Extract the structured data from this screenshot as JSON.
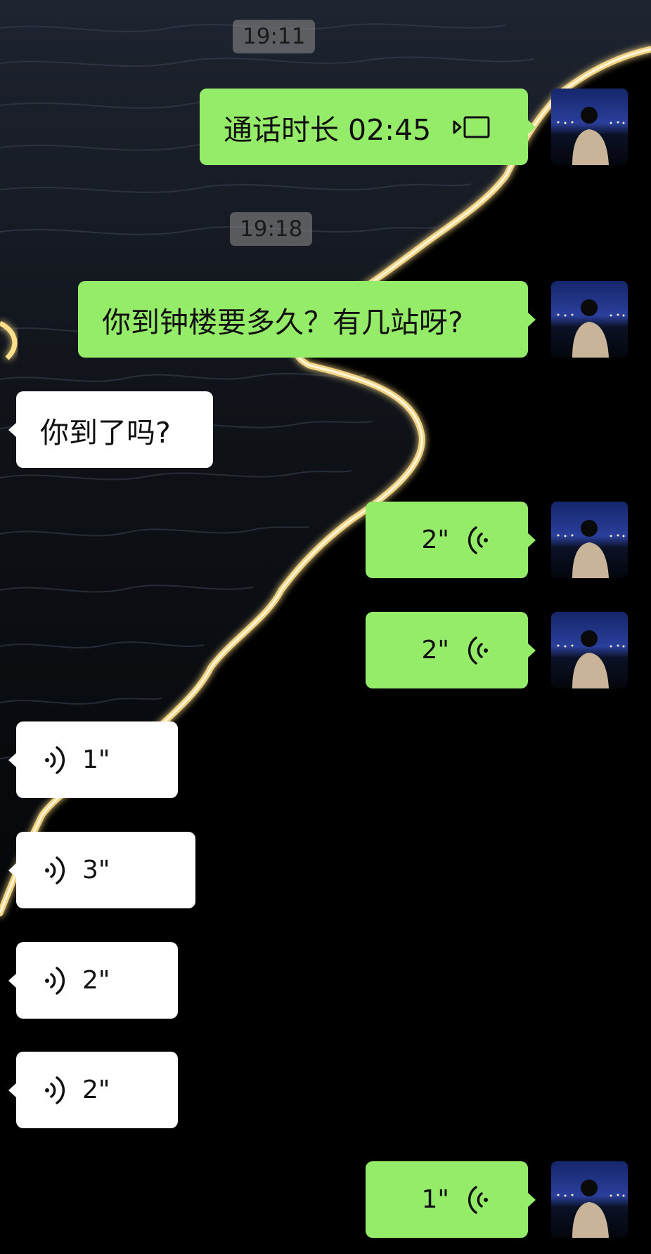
{
  "chat": {
    "time_1": "19:11",
    "time_2": "19:18",
    "call_text": "通话时长 02:45",
    "msg_question": "你到钟楼要多久？有几站呀?",
    "msg_arrived": "你到了吗?",
    "voice_out_1": "2\"",
    "voice_out_2": "2\"",
    "voice_in_1": "1\"",
    "voice_in_2": "3\"",
    "voice_in_3": "2\"",
    "voice_in_4": "2\"",
    "voice_out_3": "1\""
  },
  "icons": {
    "call": "video-call-icon",
    "voice_out": "voice-wave-left-icon",
    "voice_in": "voice-wave-right-icon"
  },
  "colors": {
    "outgoing_bubble": "#95ec69",
    "incoming_bubble": "#ffffff",
    "background": "#000000",
    "wave_glow": "#ffe08a"
  }
}
